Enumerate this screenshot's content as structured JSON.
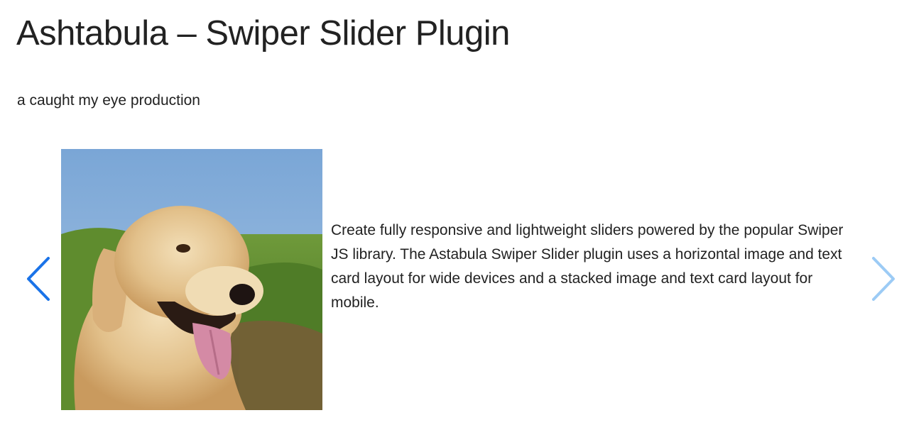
{
  "header": {
    "title": "Ashtabula – Swiper Slider Plugin",
    "tagline": "a caught my eye production"
  },
  "slider": {
    "prev_icon": "chevron-left-icon",
    "next_icon": "chevron-right-icon",
    "prev_color": "#1a73e8",
    "next_color": "#9ccbf5",
    "slide": {
      "image_subject": "golden-retriever-photo",
      "text": "Create fully responsive and lightweight sliders powered by the popular Swiper JS library. The Astabula Swiper Slider plugin uses a horizontal image and text card layout for wide devices and a stacked image and text card layout for mobile."
    }
  }
}
